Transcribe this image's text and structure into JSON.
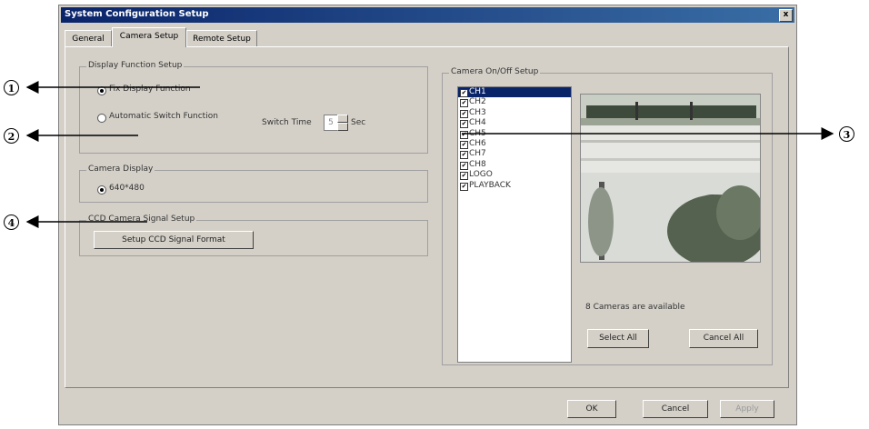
{
  "window": {
    "title": "System Configuration Setup",
    "close_glyph": "x"
  },
  "tabs": [
    {
      "label": "General"
    },
    {
      "label": "Camera Setup",
      "active": true
    },
    {
      "label": "Remote Setup"
    }
  ],
  "display_function": {
    "legend": "Display Function Setup",
    "fix_label": "Fix Display Function",
    "fix_selected": true,
    "auto_label": "Automatic Switch Function",
    "switch_time_label": "Switch Time",
    "switch_time_value": "5",
    "sec_label": "Sec"
  },
  "camera_display": {
    "legend": "Camera Display",
    "option_label": "640*480",
    "selected": true
  },
  "ccd": {
    "legend": "CCD Camera Signal Setup",
    "button_label": "Setup CCD Signal Format"
  },
  "camera_onoff": {
    "legend": "Camera On/Off Setup",
    "items": [
      {
        "label": "CH1",
        "checked": true,
        "selected": true
      },
      {
        "label": "CH2",
        "checked": true
      },
      {
        "label": "CH3",
        "checked": true
      },
      {
        "label": "CH4",
        "checked": true
      },
      {
        "label": "CH5",
        "checked": true
      },
      {
        "label": "CH6",
        "checked": true
      },
      {
        "label": "CH7",
        "checked": true
      },
      {
        "label": "CH8",
        "checked": true
      },
      {
        "label": "LOGO",
        "checked": true
      },
      {
        "label": "PLAYBACK",
        "checked": true
      }
    ],
    "status": "8 Cameras are available",
    "select_all": "Select All",
    "cancel_all": "Cancel All"
  },
  "footer": {
    "ok": "OK",
    "cancel": "Cancel",
    "apply": "Apply"
  },
  "callouts": [
    "1",
    "2",
    "3",
    "4"
  ],
  "colors": {
    "title_bar": "#0a246a",
    "selection": "#0a246a",
    "dialog_bg": "#d4d0c8"
  }
}
